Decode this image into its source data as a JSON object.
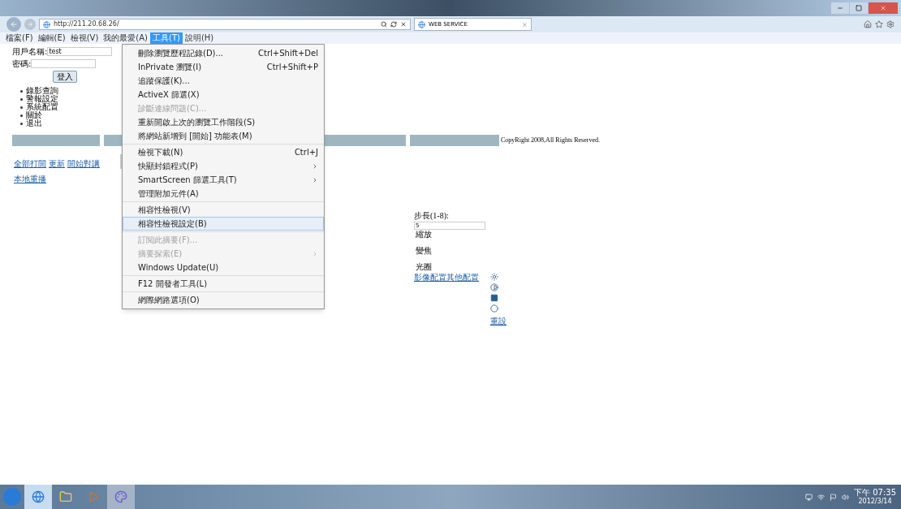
{
  "browser": {
    "address": "http://211.20.68.26/",
    "tab_title": "WEB SERVICE"
  },
  "menubar": [
    {
      "label": "檔案(F)",
      "selected": false
    },
    {
      "label": "編輯(E)",
      "selected": false
    },
    {
      "label": "檢視(V)",
      "selected": false
    },
    {
      "label": "我的最愛(A)",
      "selected": false
    },
    {
      "label": "工具(T)",
      "selected": true
    },
    {
      "label": "說明(H)",
      "selected": false
    }
  ],
  "tools_menu": {
    "groups": [
      [
        {
          "label": "刪除瀏覽歷程記錄(D)...",
          "shortcut": "Ctrl+Shift+Del",
          "disabled": false,
          "has_submenu": false,
          "selected": false
        },
        {
          "label": "InPrivate 瀏覽(I)",
          "shortcut": "Ctrl+Shift+P",
          "disabled": false,
          "has_submenu": false,
          "selected": false
        },
        {
          "label": "追蹤保護(K)...",
          "disabled": false,
          "has_submenu": false,
          "selected": false
        },
        {
          "label": "ActiveX 篩選(X)",
          "disabled": false,
          "has_submenu": false,
          "selected": false
        },
        {
          "label": "診斷連線問題(C)...",
          "disabled": true,
          "has_submenu": false,
          "selected": false
        },
        {
          "label": "重新開啟上次的瀏覽工作階段(S)",
          "disabled": false,
          "has_submenu": false,
          "selected": false
        },
        {
          "label": "將網站新增到 [開始] 功能表(M)",
          "disabled": false,
          "has_submenu": false,
          "selected": false
        }
      ],
      [
        {
          "label": "檢視下載(N)",
          "shortcut": "Ctrl+J",
          "disabled": false,
          "has_submenu": false,
          "selected": false
        },
        {
          "label": "快顯封鎖程式(P)",
          "disabled": false,
          "has_submenu": true,
          "selected": false
        },
        {
          "label": "SmartScreen 篩選工具(T)",
          "disabled": false,
          "has_submenu": true,
          "selected": false
        },
        {
          "label": "管理附加元件(A)",
          "disabled": false,
          "has_submenu": false,
          "selected": false
        }
      ],
      [
        {
          "label": "相容性檢視(V)",
          "disabled": false,
          "has_submenu": false,
          "selected": false
        },
        {
          "label": "相容性檢視設定(B)",
          "disabled": false,
          "has_submenu": false,
          "selected": true
        }
      ],
      [
        {
          "label": "訂閱此摘要(F)...",
          "disabled": true,
          "has_submenu": false,
          "selected": false
        },
        {
          "label": "摘要探索(E)",
          "disabled": true,
          "has_submenu": true,
          "selected": false
        },
        {
          "label": "Windows Update(U)",
          "disabled": false,
          "has_submenu": false,
          "selected": false
        }
      ],
      [
        {
          "label": "F12 開發者工具(L)",
          "disabled": false,
          "has_submenu": false,
          "selected": false
        }
      ],
      [
        {
          "label": "網際網路選項(O)",
          "disabled": false,
          "has_submenu": false,
          "selected": false
        }
      ]
    ]
  },
  "login": {
    "username_label": "用戶名稱:",
    "username_value": "test",
    "password_label": "密碼:",
    "login_button": "登入"
  },
  "nav": [
    "錄影查詢",
    "警報設定",
    "系統配置",
    "關於",
    "退出"
  ],
  "links": [
    "全部打開",
    "更新",
    "開始對講"
  ],
  "playback_link": "本地重播",
  "copyright": "CopyRight 2008,All Rights Reserved.",
  "ptz": {
    "step_label": "步長(1-8):",
    "step_value": "5",
    "labels": [
      "縮放",
      "變焦",
      "光圈"
    ],
    "config_link": "影像配置其他配置",
    "reset_link": "重設"
  },
  "taskbar": {
    "time": "下午 07:35",
    "date": "2012/3/14"
  }
}
